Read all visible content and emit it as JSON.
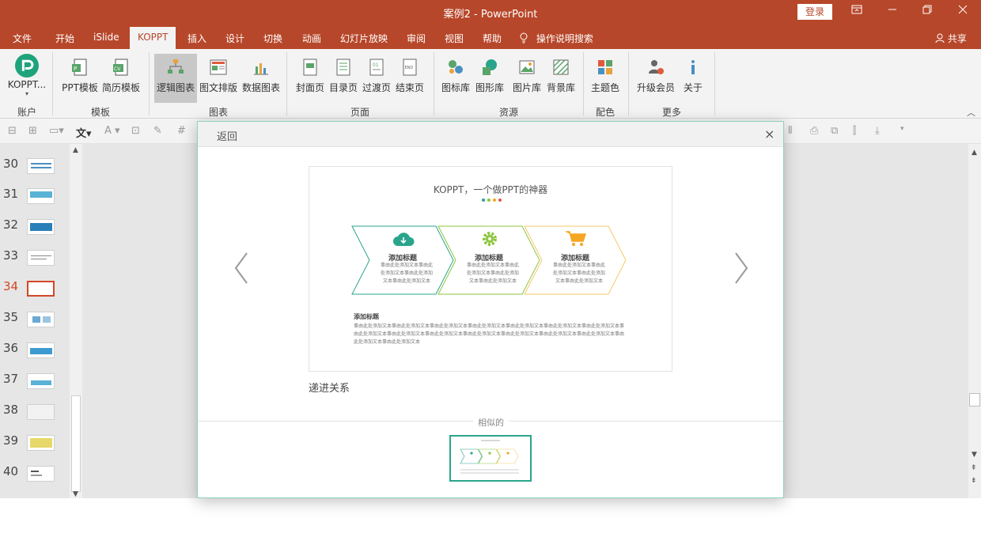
{
  "window": {
    "title": "案例2  -  PowerPoint",
    "login_label": "登录"
  },
  "menu": {
    "items": [
      "文件",
      "开始",
      "iSlide",
      "KOPPT",
      "插入",
      "设计",
      "切换",
      "动画",
      "幻灯片放映",
      "审阅",
      "视图",
      "帮助"
    ],
    "active": "KOPPT",
    "tell_me": "操作说明搜索",
    "share": "共享"
  },
  "ribbon": {
    "buttons": {
      "koppt": "KOPPT...",
      "ppt_template": "PPT模板",
      "resume_template": "简历模板",
      "logic_chart": "逻辑图表",
      "image_text_layout": "图文排版",
      "data_chart": "数据图表",
      "cover": "封面页",
      "toc": "目录页",
      "transition": "过渡页",
      "end": "结束页",
      "icon_lib": "图标库",
      "shape_lib": "图形库",
      "image_lib": "图片库",
      "background_lib": "背景库",
      "theme_color": "主题色",
      "upgrade": "升级会员",
      "about": "关于"
    },
    "groups": {
      "account": "账户",
      "template": "模板",
      "chart": "图表",
      "page": "页面",
      "resource": "资源",
      "color": "配色",
      "more": "更多"
    }
  },
  "slides": {
    "numbers": [
      "30",
      "31",
      "32",
      "33",
      "34",
      "35",
      "36",
      "37",
      "38",
      "39",
      "40"
    ],
    "current": "34"
  },
  "modal": {
    "back_label": "返回",
    "preview": {
      "title": "KOPPT，一个做PPT的神器",
      "steps": [
        {
          "title": "添加标题",
          "body": "事由此处添加文本事由此处添加文本事由此处添加文本事由此处添加文本"
        },
        {
          "title": "添加标题",
          "body": "事由此处添加文本事由此处添加文本事由此处添加文本事由此处添加文本"
        },
        {
          "title": "添加标题",
          "body": "事由此处添加文本事由此处添加文本事由此处添加文本事由此处添加文本"
        }
      ],
      "sub_title": "添加标题",
      "sub_body": "事由此处添加文本事由此处添加文本事由此处添加文本事由此处添加文本事由此处添加文本事由此处添加文本事由此处添加文本事由此处添加文本事由此处添加文本事由此处添加文本事由此处添加文本事由此处添加文本事由此处添加文本事由此处添加文本事由此处添加文本事由此处添加文本"
    },
    "caption": "递进关系",
    "similar_label": "相似的"
  },
  "colors": {
    "brand": "#b7472a",
    "accent_teal": "#2aa58c",
    "accent_green": "#8dc63f",
    "accent_orange": "#f5a623",
    "current_slide": "#d24726"
  }
}
